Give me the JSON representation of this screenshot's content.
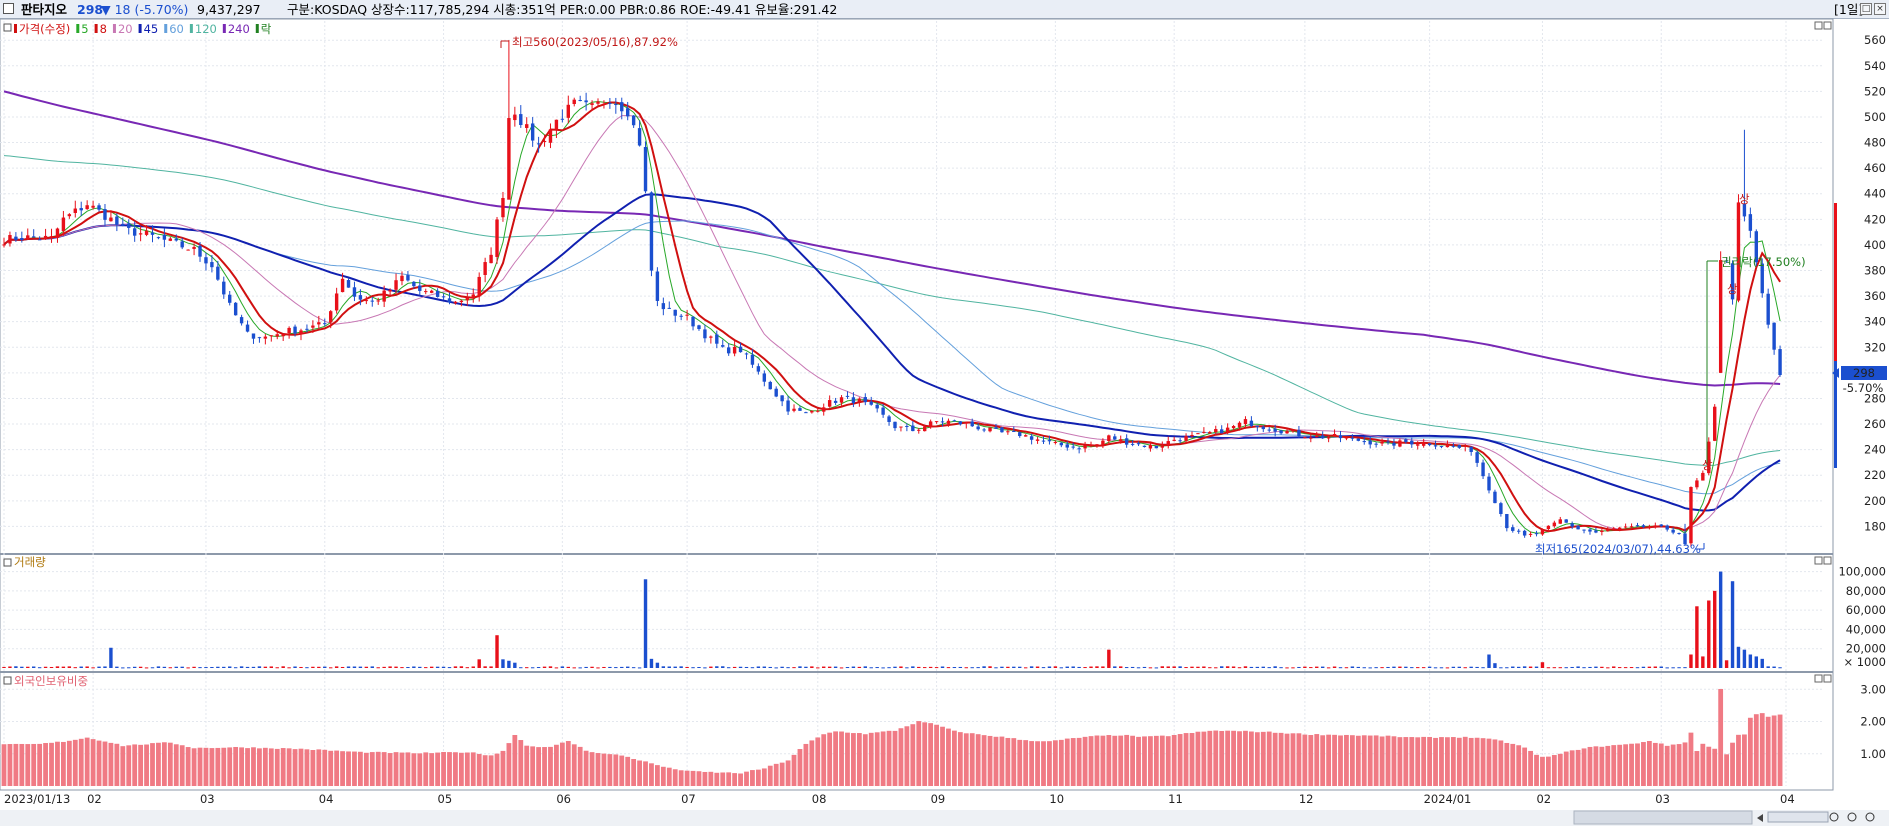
{
  "header": {
    "name": "판타지오",
    "price": "298",
    "change": "▼ 18 (-5.70%)",
    "volume": "9,437,297",
    "info": "구분:KOSDAQ 상장수:117,785,294 시총:351억 PER:0.00 PBR:0.86 ROE:-49.41 유보율:291.42",
    "period_button": "[1일]",
    "colors": {
      "up": "#e8101a",
      "down": "#1b4fcf",
      "header_bg": "#e9eef6"
    }
  },
  "price_panel": {
    "legend": [
      {
        "label": "가격(수정)",
        "color": "#d01010"
      },
      {
        "label": "5",
        "color": "#28a828"
      },
      {
        "label": "8",
        "color": "#d01010"
      },
      {
        "label": "20",
        "color": "#c878b4"
      },
      {
        "label": "45",
        "color": "#1020b0"
      },
      {
        "label": "60",
        "color": "#64a0dc"
      },
      {
        "label": "120",
        "color": "#50b4a0"
      },
      {
        "label": "240",
        "color": "#7828b4"
      },
      {
        "label": "락",
        "color": "#208020"
      }
    ],
    "high_annotation": "최고560(2023/05/16),87.92%",
    "low_annotation": "최저165(2024/03/07),44.63%",
    "rights_annotation": "권리락(17.50%)",
    "limit_up_marks": [
      "상",
      "상",
      "상"
    ],
    "current_price_label": "298",
    "current_change_label": "-5.70%"
  },
  "volume_panel": {
    "title": "거래량",
    "unit": "× 1000"
  },
  "foreign_panel": {
    "title": "외국인보유비중"
  },
  "chart_data": [
    {
      "type": "candlestick",
      "title": "가격(수정)",
      "ylim": [
        160,
        575
      ],
      "y_ticks": [
        180,
        200,
        220,
        240,
        260,
        280,
        300,
        320,
        340,
        360,
        380,
        400,
        420,
        440,
        460,
        480,
        500,
        520,
        540,
        560
      ],
      "x_tick_labels": [
        "2023/01/13",
        "02",
        "03",
        "04",
        "05",
        "06",
        "07",
        "08",
        "09",
        "10",
        "11",
        "12",
        "2024/01",
        "02",
        "03",
        "04"
      ],
      "x_tick_index": [
        0,
        15,
        34,
        54,
        74,
        94,
        115,
        137,
        157,
        177,
        197,
        219,
        240,
        259,
        279,
        300
      ],
      "ohlc_keypoints": [
        [
          0,
          404
        ],
        [
          3,
          406
        ],
        [
          8,
          405
        ],
        [
          10,
          420
        ],
        [
          14,
          432
        ],
        [
          18,
          420
        ],
        [
          20,
          412
        ],
        [
          24,
          408
        ],
        [
          28,
          402
        ],
        [
          32,
          396
        ],
        [
          35,
          384
        ],
        [
          38,
          352
        ],
        [
          41,
          330
        ],
        [
          44,
          328
        ],
        [
          47,
          332
        ],
        [
          50,
          334
        ],
        [
          54,
          338
        ],
        [
          57,
          375
        ],
        [
          59,
          360
        ],
        [
          62,
          355
        ],
        [
          65,
          365
        ],
        [
          67,
          375
        ],
        [
          70,
          364
        ],
        [
          73,
          360
        ],
        [
          76,
          355
        ],
        [
          79,
          362
        ],
        [
          82,
          395
        ],
        [
          84,
          440
        ],
        [
          85,
          500
        ],
        [
          86,
          505
        ],
        [
          88,
          490
        ],
        [
          90,
          478
        ],
        [
          93,
          497
        ],
        [
          96,
          510
        ],
        [
          99,
          507
        ],
        [
          102,
          515
        ],
        [
          105,
          505
        ],
        [
          107,
          480
        ],
        [
          108,
          440
        ],
        [
          109,
          380
        ],
        [
          110,
          355
        ],
        [
          112,
          348
        ],
        [
          115,
          343
        ],
        [
          118,
          330
        ],
        [
          121,
          318
        ],
        [
          124,
          318
        ],
        [
          127,
          300
        ],
        [
          130,
          283
        ],
        [
          132,
          272
        ],
        [
          135,
          268
        ],
        [
          138,
          275
        ],
        [
          141,
          280
        ],
        [
          144,
          278
        ],
        [
          147,
          270
        ],
        [
          150,
          258
        ],
        [
          153,
          255
        ],
        [
          157,
          262
        ],
        [
          159,
          262
        ],
        [
          162,
          260
        ],
        [
          165,
          256
        ],
        [
          168,
          253
        ],
        [
          171,
          252
        ],
        [
          174,
          248
        ],
        [
          177,
          244
        ],
        [
          181,
          242
        ],
        [
          184,
          244
        ],
        [
          186,
          250
        ],
        [
          188,
          247
        ],
        [
          191,
          244
        ],
        [
          194,
          242
        ],
        [
          197,
          248
        ],
        [
          200,
          250
        ],
        [
          203,
          253
        ],
        [
          206,
          256
        ],
        [
          209,
          262
        ],
        [
          212,
          258
        ],
        [
          215,
          255
        ],
        [
          218,
          252
        ],
        [
          221,
          250
        ],
        [
          224,
          250
        ],
        [
          227,
          248
        ],
        [
          230,
          246
        ],
        [
          233,
          244
        ],
        [
          236,
          246
        ],
        [
          240,
          245
        ],
        [
          243,
          243
        ],
        [
          247,
          240
        ],
        [
          250,
          210
        ],
        [
          253,
          180
        ],
        [
          256,
          172
        ],
        [
          259,
          176
        ],
        [
          262,
          185
        ],
        [
          265,
          178
        ],
        [
          268,
          175
        ],
        [
          271,
          178
        ],
        [
          274,
          179
        ],
        [
          277,
          180
        ],
        [
          280,
          178
        ],
        [
          282,
          175
        ],
        [
          283,
          165
        ],
        [
          284,
          210
        ],
        [
          286,
          220
        ],
        [
          287,
          245
        ],
        [
          288,
          275
        ],
        [
          289,
          390
        ],
        [
          290,
          385
        ],
        [
          291,
          360
        ],
        [
          292,
          430
        ],
        [
          293,
          420
        ],
        [
          294,
          410
        ],
        [
          295,
          385
        ],
        [
          296,
          362
        ],
        [
          297,
          338
        ],
        [
          298,
          316
        ],
        [
          299,
          298
        ]
      ],
      "extreme_overrides": [
        {
          "index": 85,
          "high": 560,
          "low": 470
        },
        {
          "index": 283,
          "high": 182,
          "low": 165
        },
        {
          "index": 289,
          "open": 300,
          "high": 395,
          "low": 300
        },
        {
          "index": 293,
          "high": 490
        }
      ]
    },
    {
      "type": "bar",
      "title": "거래량",
      "ylim": [
        0,
        112000
      ],
      "y_ticks": [
        20000,
        40000,
        60000,
        80000,
        100000
      ],
      "spikes": [
        {
          "index": 18,
          "value": 21000,
          "color": "down"
        },
        {
          "index": 80,
          "value": 9000,
          "color": "up"
        },
        {
          "index": 83,
          "value": 34000,
          "color": "up"
        },
        {
          "index": 84,
          "value": 9000,
          "color": "down"
        },
        {
          "index": 85,
          "value": 7500,
          "color": "down"
        },
        {
          "index": 86,
          "value": 5500,
          "color": "down"
        },
        {
          "index": 108,
          "value": 92000,
          "color": "down"
        },
        {
          "index": 109,
          "value": 9500,
          "color": "down"
        },
        {
          "index": 110,
          "value": 5500,
          "color": "down"
        },
        {
          "index": 186,
          "value": 19000,
          "color": "up"
        },
        {
          "index": 250,
          "value": 14000,
          "color": "down"
        },
        {
          "index": 251,
          "value": 5000,
          "color": "down"
        },
        {
          "index": 259,
          "value": 6000,
          "color": "up"
        },
        {
          "index": 284,
          "value": 14000,
          "color": "up"
        },
        {
          "index": 285,
          "value": 64000,
          "color": "up"
        },
        {
          "index": 286,
          "value": 12000,
          "color": "up"
        },
        {
          "index": 287,
          "value": 70000,
          "color": "up"
        },
        {
          "index": 288,
          "value": 80000,
          "color": "up"
        },
        {
          "index": 289,
          "value": 100000,
          "color": "down"
        },
        {
          "index": 290,
          "value": 8000,
          "color": "up"
        },
        {
          "index": 291,
          "value": 90000,
          "color": "down"
        },
        {
          "index": 292,
          "value": 22000,
          "color": "down"
        },
        {
          "index": 293,
          "value": 19000,
          "color": "down"
        },
        {
          "index": 294,
          "value": 14000,
          "color": "down"
        },
        {
          "index": 295,
          "value": 12000,
          "color": "down"
        },
        {
          "index": 296,
          "value": 9500,
          "color": "down"
        }
      ]
    },
    {
      "type": "bar",
      "title": "외국인보유비중",
      "ylim": [
        0,
        3.35
      ],
      "y_ticks": [
        1.0,
        2.0,
        3.0
      ],
      "keypoints": [
        [
          0,
          1.28
        ],
        [
          6,
          1.3
        ],
        [
          10,
          1.38
        ],
        [
          14,
          1.5
        ],
        [
          18,
          1.35
        ],
        [
          20,
          1.25
        ],
        [
          24,
          1.3
        ],
        [
          28,
          1.35
        ],
        [
          32,
          1.18
        ],
        [
          40,
          1.2
        ],
        [
          50,
          1.15
        ],
        [
          60,
          1.05
        ],
        [
          70,
          1.02
        ],
        [
          78,
          1.05
        ],
        [
          82,
          0.95
        ],
        [
          84,
          1.08
        ],
        [
          86,
          1.6
        ],
        [
          88,
          1.25
        ],
        [
          92,
          1.2
        ],
        [
          95,
          1.4
        ],
        [
          98,
          1.1
        ],
        [
          101,
          1.0
        ],
        [
          104,
          0.95
        ],
        [
          108,
          0.75
        ],
        [
          112,
          0.55
        ],
        [
          116,
          0.45
        ],
        [
          120,
          0.42
        ],
        [
          124,
          0.4
        ],
        [
          128,
          0.55
        ],
        [
          132,
          0.8
        ],
        [
          135,
          1.3
        ],
        [
          138,
          1.6
        ],
        [
          140,
          1.7
        ],
        [
          145,
          1.62
        ],
        [
          150,
          1.72
        ],
        [
          154,
          2.0
        ],
        [
          157,
          1.9
        ],
        [
          160,
          1.7
        ],
        [
          164,
          1.6
        ],
        [
          168,
          1.52
        ],
        [
          172,
          1.42
        ],
        [
          176,
          1.38
        ],
        [
          180,
          1.48
        ],
        [
          184,
          1.55
        ],
        [
          188,
          1.58
        ],
        [
          192,
          1.52
        ],
        [
          196,
          1.56
        ],
        [
          200,
          1.65
        ],
        [
          204,
          1.72
        ],
        [
          208,
          1.7
        ],
        [
          212,
          1.68
        ],
        [
          216,
          1.64
        ],
        [
          220,
          1.6
        ],
        [
          226,
          1.58
        ],
        [
          232,
          1.55
        ],
        [
          238,
          1.5
        ],
        [
          244,
          1.52
        ],
        [
          248,
          1.5
        ],
        [
          252,
          1.4
        ],
        [
          256,
          1.2
        ],
        [
          258,
          0.95
        ],
        [
          260,
          0.9
        ],
        [
          263,
          1.05
        ],
        [
          266,
          1.18
        ],
        [
          270,
          1.25
        ],
        [
          274,
          1.3
        ],
        [
          277,
          1.4
        ],
        [
          280,
          1.25
        ],
        [
          283,
          1.35
        ],
        [
          284,
          1.65
        ],
        [
          285,
          1.1
        ],
        [
          286,
          1.3
        ],
        [
          288,
          1.15
        ],
        [
          289,
          3.0
        ],
        [
          290,
          1.0
        ],
        [
          291,
          1.35
        ],
        [
          292,
          1.6
        ],
        [
          293,
          1.6
        ],
        [
          294,
          2.1
        ],
        [
          295,
          2.22
        ],
        [
          296,
          2.25
        ],
        [
          297,
          2.15
        ],
        [
          299,
          2.2
        ]
      ]
    }
  ]
}
